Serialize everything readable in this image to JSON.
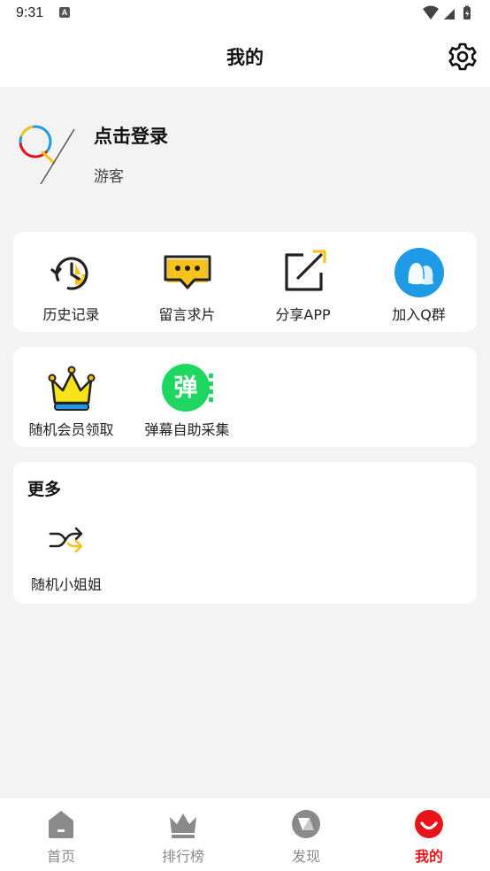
{
  "status_bar": {
    "time": "9:31",
    "notification_letter": "A",
    "icons": [
      "wifi-icon",
      "cell-signal-icon",
      "battery-icon"
    ]
  },
  "header": {
    "title": "我的",
    "settings_icon": "gear-icon"
  },
  "profile": {
    "login_label": "点击登录",
    "role": "游客"
  },
  "quick_actions": [
    {
      "label": "历史记录",
      "icon": "history-icon"
    },
    {
      "label": "留言求片",
      "icon": "message-icon"
    },
    {
      "label": "分享APP",
      "icon": "share-icon"
    },
    {
      "label": "加入Q群",
      "icon": "qq-group-icon"
    }
  ],
  "features": [
    {
      "label": "随机会员领取",
      "icon": "crown-icon"
    },
    {
      "label": "弹幕自助采集",
      "icon": "danmaku-icon",
      "badge_text": "弹"
    }
  ],
  "more": {
    "title": "更多",
    "items": [
      {
        "label": "随机小姐姐",
        "icon": "shuffle-icon"
      }
    ]
  },
  "bottom_nav": [
    {
      "label": "首页",
      "icon": "home-icon",
      "active": false
    },
    {
      "label": "排行榜",
      "icon": "crown-rank-icon",
      "active": false
    },
    {
      "label": "发现",
      "icon": "discover-icon",
      "active": false
    },
    {
      "label": "我的",
      "icon": "mine-icon",
      "active": true
    }
  ],
  "colors": {
    "accent": "#e8141c",
    "yellow": "#f7c21b",
    "qq_blue": "#1f9be6",
    "danmaku_green": "#1ed760",
    "background": "#f3f3f3"
  }
}
